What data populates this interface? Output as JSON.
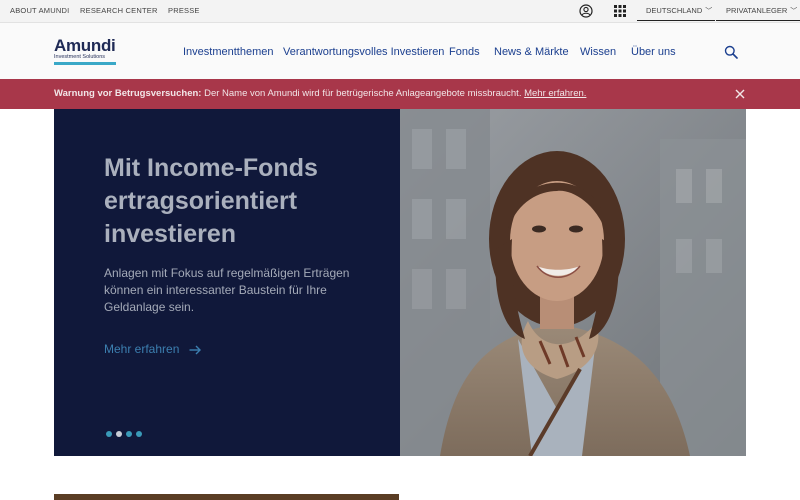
{
  "topbar": {
    "links": [
      "ABOUT AMUNDI",
      "RESEARCH CENTER",
      "PRESSE"
    ],
    "country": "DEUTSCHLAND",
    "audience": "PRIVATANLEGER"
  },
  "header": {
    "logo_name": "Amundi",
    "logo_sub": "Investment Solutions",
    "nav": [
      "Investmentthemen",
      "Verantwortungsvolles Investieren",
      "Fonds",
      "News & Märkte",
      "Wissen",
      "Über uns"
    ]
  },
  "alert": {
    "label": "Warnung vor Betrugsversuchen:",
    "text": " Der Name von Amundi wird für betrügerische Anlageangebote missbraucht. ",
    "link": "Mehr erfahren."
  },
  "hero": {
    "title": "Mit Income-Fonds ertragsorientiert investieren",
    "text": "Anlagen mit Fokus auf regelmäßigen Erträgen können ein interessanter Baustein für Ihre Geldanlage sein.",
    "cta": "Mehr erfahren",
    "slides": 4,
    "active_slide": 2
  },
  "colors": {
    "brand_navy": "#1f2a55",
    "nav_blue": "#1b3f8f",
    "alert_red": "#a8374a",
    "hero_bg": "#10183a",
    "accent_teal": "#3a9ab8"
  },
  "icons": [
    "user-icon",
    "apps-grid-icon",
    "search-icon",
    "close-icon",
    "arrow-right-icon"
  ]
}
